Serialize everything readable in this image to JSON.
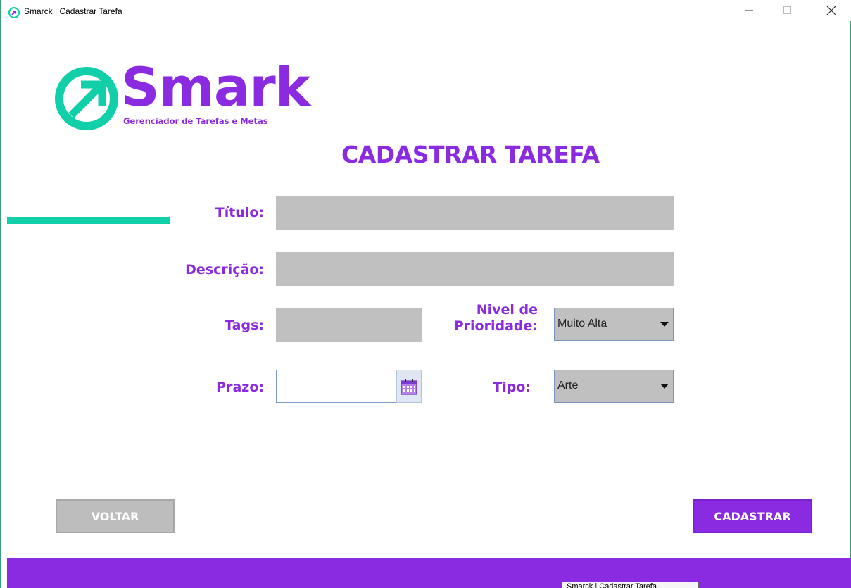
{
  "window": {
    "title": "Smarck | Cadastrar Tarefa",
    "icon": "smark-logo-icon"
  },
  "logo": {
    "brand": "Smark",
    "subtitle": "Gerenciador de Tarefas e Metas",
    "icon": "smark-arrow-icon"
  },
  "page_title": "CADASTRAR TAREFA",
  "form": {
    "titulo_label": "Título:",
    "titulo_value": "",
    "descricao_label": "Descrição:",
    "descricao_value": "",
    "tags_label": "Tags:",
    "tags_value": "",
    "prioridade_label_line1": "Nivel de",
    "prioridade_label_line2": "Prioridade:",
    "prioridade_value": "Muito Alta",
    "prazo_label": "Prazo:",
    "prazo_value": "",
    "tipo_label": "Tipo:",
    "tipo_value": "Arte"
  },
  "buttons": {
    "voltar": "VOLTAR",
    "cadastrar": "CADASTRAR"
  },
  "tooltip": "Smarck | Cadastrar Tarefa",
  "colors": {
    "accent": "#8a2be2",
    "teal": "#11cfa9",
    "field_bg": "#c0c0c0"
  }
}
